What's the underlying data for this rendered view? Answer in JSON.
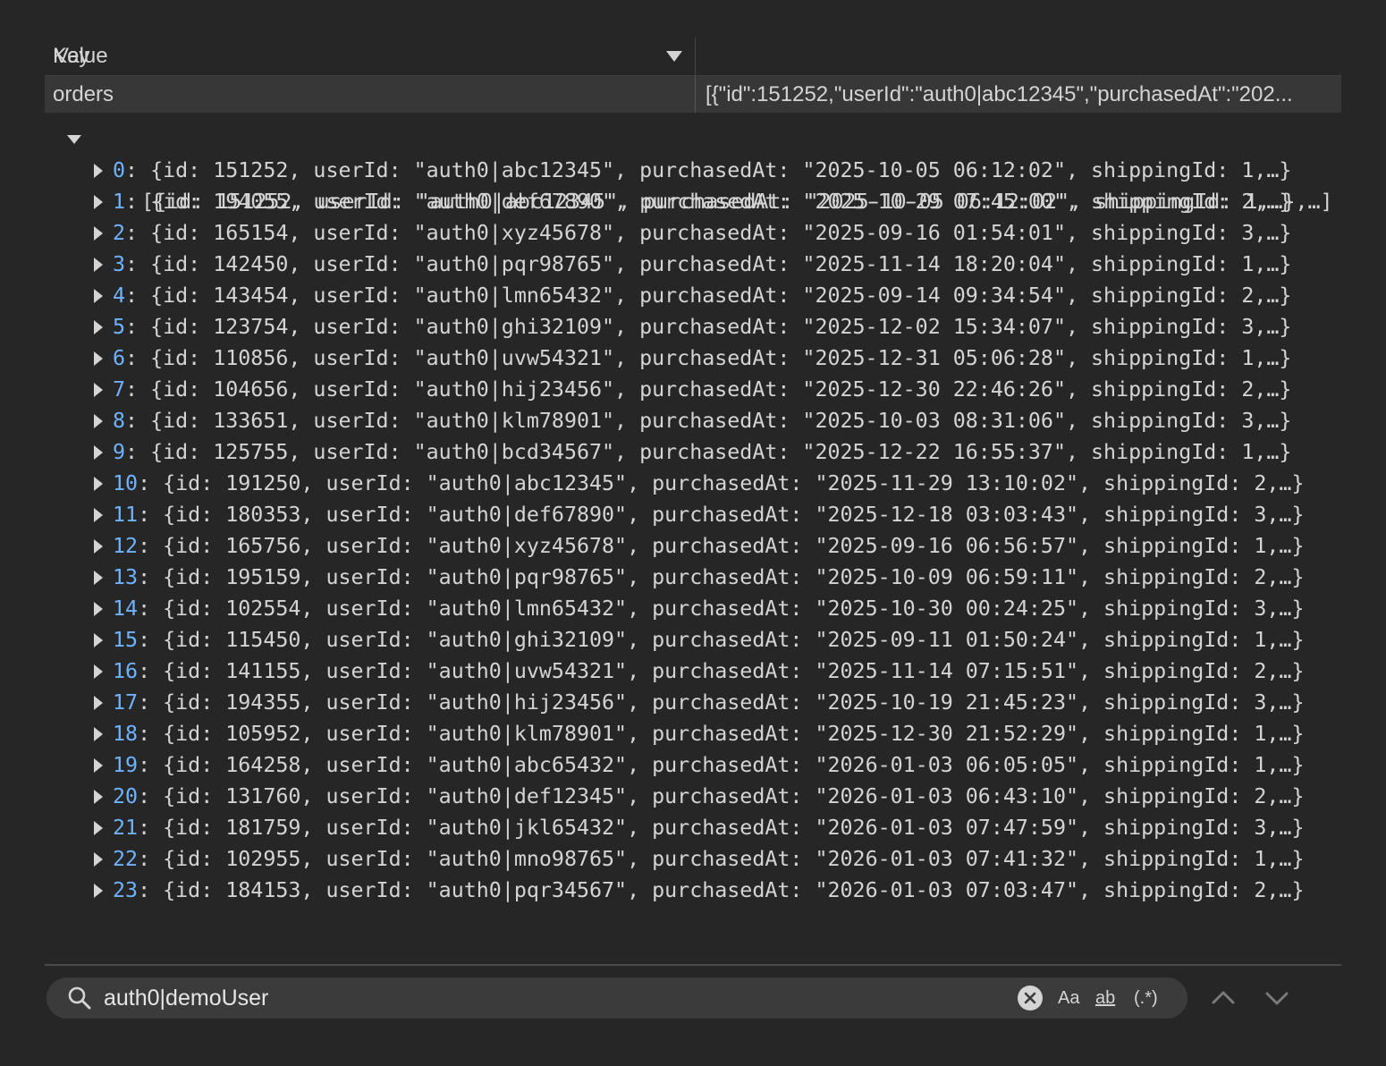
{
  "table": {
    "columns": {
      "key": "Key",
      "value": "Value"
    },
    "row": {
      "key": "orders",
      "value": "[{\"id\":151252,\"userId\":\"auth0|abc12345\",\"purchasedAt\":\"202..."
    }
  },
  "tree": {
    "root": "[{id: 151252, userId: \"auth0|abc12345\", purchasedAt: \"2025-10-05 06:12:02\", shippingId: 1,…},…]",
    "items": [
      {
        "index": "0",
        "text": ": {id: 151252, userId: \"auth0|abc12345\", purchasedAt: \"2025-10-05 06:12:02\", shippingId: 1,…}"
      },
      {
        "index": "1",
        "text": ": {id: 194055, userId: \"auth0|def67890\", purchasedAt: \"2025-10-29 07:45:00\", shippingId: 2,…}"
      },
      {
        "index": "2",
        "text": ": {id: 165154, userId: \"auth0|xyz45678\", purchasedAt: \"2025-09-16 01:54:01\", shippingId: 3,…}"
      },
      {
        "index": "3",
        "text": ": {id: 142450, userId: \"auth0|pqr98765\", purchasedAt: \"2025-11-14 18:20:04\", shippingId: 1,…}"
      },
      {
        "index": "4",
        "text": ": {id: 143454, userId: \"auth0|lmn65432\", purchasedAt: \"2025-09-14 09:34:54\", shippingId: 2,…}"
      },
      {
        "index": "5",
        "text": ": {id: 123754, userId: \"auth0|ghi32109\", purchasedAt: \"2025-12-02 15:34:07\", shippingId: 3,…}"
      },
      {
        "index": "6",
        "text": ": {id: 110856, userId: \"auth0|uvw54321\", purchasedAt: \"2025-12-31 05:06:28\", shippingId: 1,…}"
      },
      {
        "index": "7",
        "text": ": {id: 104656, userId: \"auth0|hij23456\", purchasedAt: \"2025-12-30 22:46:26\", shippingId: 2,…}"
      },
      {
        "index": "8",
        "text": ": {id: 133651, userId: \"auth0|klm78901\", purchasedAt: \"2025-10-03 08:31:06\", shippingId: 3,…}"
      },
      {
        "index": "9",
        "text": ": {id: 125755, userId: \"auth0|bcd34567\", purchasedAt: \"2025-12-22 16:55:37\", shippingId: 1,…}"
      },
      {
        "index": "10",
        "text": ": {id: 191250, userId: \"auth0|abc12345\", purchasedAt: \"2025-11-29 13:10:02\", shippingId: 2,…}"
      },
      {
        "index": "11",
        "text": ": {id: 180353, userId: \"auth0|def67890\", purchasedAt: \"2025-12-18 03:03:43\", shippingId: 3,…}"
      },
      {
        "index": "12",
        "text": ": {id: 165756, userId: \"auth0|xyz45678\", purchasedAt: \"2025-09-16 06:56:57\", shippingId: 1,…}"
      },
      {
        "index": "13",
        "text": ": {id: 195159, userId: \"auth0|pqr98765\", purchasedAt: \"2025-10-09 06:59:11\", shippingId: 2,…}"
      },
      {
        "index": "14",
        "text": ": {id: 102554, userId: \"auth0|lmn65432\", purchasedAt: \"2025-10-30 00:24:25\", shippingId: 3,…}"
      },
      {
        "index": "15",
        "text": ": {id: 115450, userId: \"auth0|ghi32109\", purchasedAt: \"2025-09-11 01:50:24\", shippingId: 1,…}"
      },
      {
        "index": "16",
        "text": ": {id: 141155, userId: \"auth0|uvw54321\", purchasedAt: \"2025-11-14 07:15:51\", shippingId: 2,…}"
      },
      {
        "index": "17",
        "text": ": {id: 194355, userId: \"auth0|hij23456\", purchasedAt: \"2025-10-19 21:45:23\", shippingId: 3,…}"
      },
      {
        "index": "18",
        "text": ": {id: 105952, userId: \"auth0|klm78901\", purchasedAt: \"2025-12-30 21:52:29\", shippingId: 1,…}"
      },
      {
        "index": "19",
        "text": ": {id: 164258, userId: \"auth0|abc65432\", purchasedAt: \"2026-01-03 06:05:05\", shippingId: 1,…}"
      },
      {
        "index": "20",
        "text": ": {id: 131760, userId: \"auth0|def12345\", purchasedAt: \"2026-01-03 06:43:10\", shippingId: 2,…}"
      },
      {
        "index": "21",
        "text": ": {id: 181759, userId: \"auth0|jkl65432\", purchasedAt: \"2026-01-03 07:47:59\", shippingId: 3,…}"
      },
      {
        "index": "22",
        "text": ": {id: 102955, userId: \"auth0|mno98765\", purchasedAt: \"2026-01-03 07:41:32\", shippingId: 1,…}"
      },
      {
        "index": "23",
        "text": ": {id: 184153, userId: \"auth0|pqr34567\", purchasedAt: \"2026-01-03 07:03:47\", shippingId: 2,…}"
      }
    ]
  },
  "search": {
    "value": "auth0|demoUser",
    "options": {
      "match_case": "Aa",
      "whole_word": "ab",
      "regex": "(.*)"
    }
  },
  "colors": {
    "background": "#262626",
    "row_highlight": "#373737",
    "index_blue": "#6fb3ff",
    "search_bar": "#3b3b3b"
  }
}
